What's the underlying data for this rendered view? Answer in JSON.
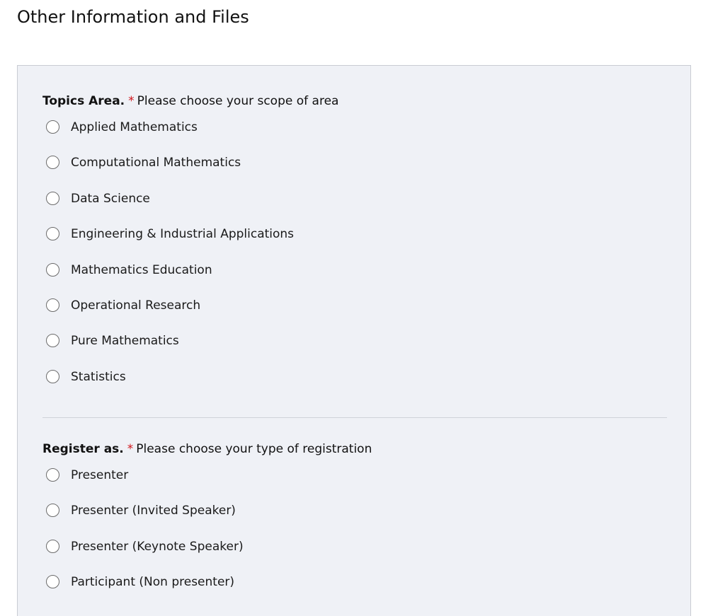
{
  "page": {
    "section_title": "Other Information and Files"
  },
  "topics": {
    "label": "Topics Area.",
    "required_mark": "*",
    "hint": "Please choose your scope of area",
    "options": [
      "Applied Mathematics",
      "Computational Mathematics",
      "Data Science",
      "Engineering & Industrial Applications",
      "Mathematics Education",
      "Operational Research",
      "Pure Mathematics",
      "Statistics"
    ]
  },
  "register": {
    "label": "Register as.",
    "required_mark": "*",
    "hint": "Please choose your type of registration",
    "options": [
      "Presenter",
      "Presenter (Invited Speaker)",
      "Presenter (Keynote Speaker)",
      "Participant (Non presenter)"
    ]
  },
  "colors": {
    "panel_background": "#eff1f6",
    "required_mark": "#d0141a",
    "radio_border": "#6b6b6b"
  }
}
